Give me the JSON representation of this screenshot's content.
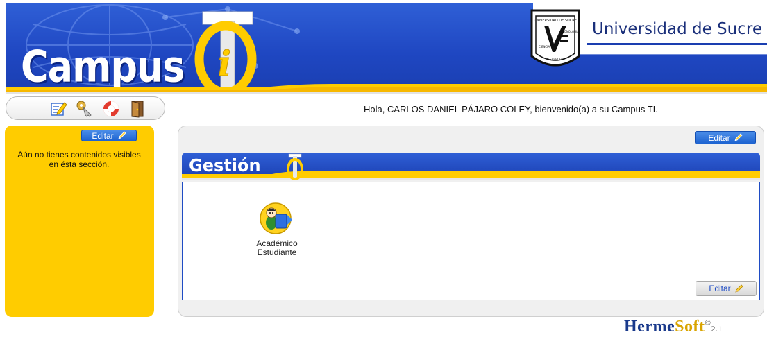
{
  "header": {
    "brand": "Campus",
    "institution": "Universidad de Sucre",
    "seal_text": [
      "UNIVERSIDAD DE SUCRE",
      "CIENCIA",
      "TECNOLOGIA",
      "DESARROLLO"
    ],
    "colors": {
      "brand_blue": "#1f47c2",
      "accent_yellow": "#ffcc00"
    }
  },
  "toolbar": {
    "icons": [
      "edit-profile-icon",
      "keys-icon",
      "help-lifebuoy-icon",
      "exit-door-icon"
    ]
  },
  "greeting": "Hola, CARLOS DANIEL PÁJARO COLEY, bienvenido(a) a su Campus TI.",
  "left_panel": {
    "edit_label": "Editar",
    "message": "Aún no tienes contenidos visibles en ésta sección."
  },
  "main": {
    "edit_label": "Editar",
    "section_title": "Gestión",
    "modules": [
      {
        "label": "Académico\nEstudiante",
        "icon": "academic-student-icon"
      }
    ],
    "content_edit_label": "Editar"
  },
  "footer": {
    "brand_part1": "Herme",
    "brand_part2": "Soft",
    "mark": "©",
    "version": "2.1"
  }
}
